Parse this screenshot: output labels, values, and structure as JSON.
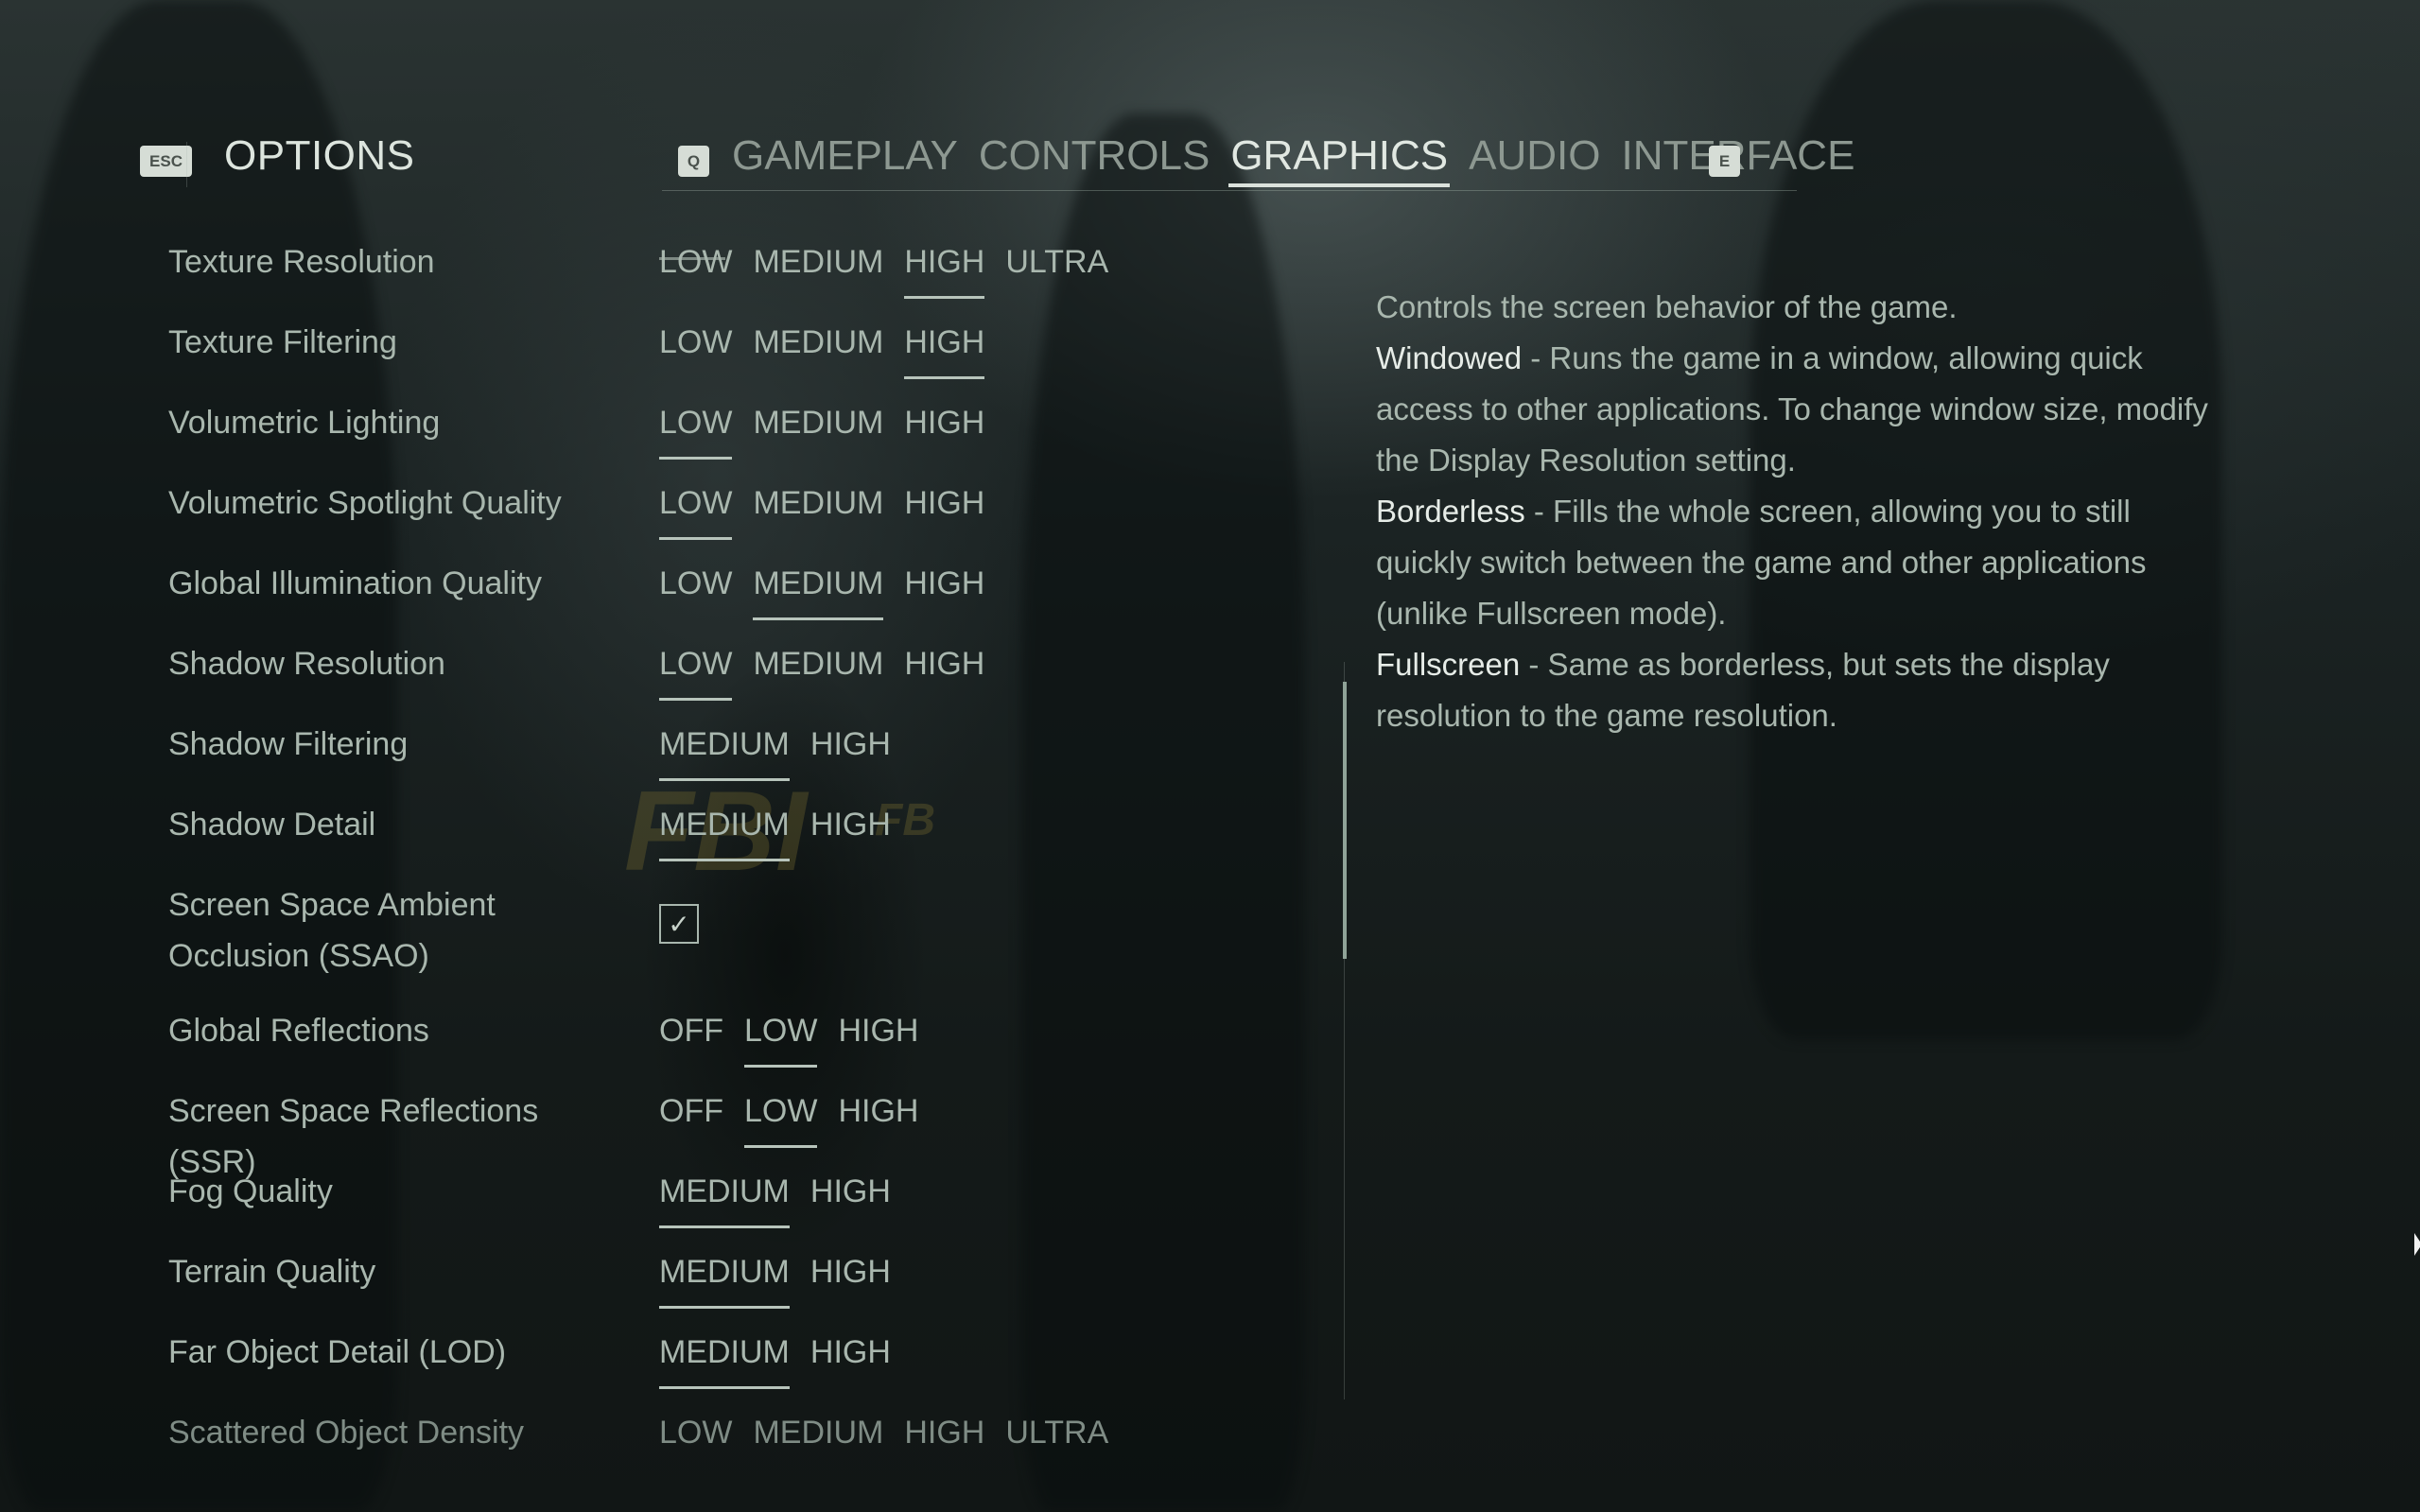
{
  "header": {
    "back_key": "ESC",
    "title": "OPTIONS",
    "prev_tab_key": "Q",
    "next_tab_key": "E",
    "tabs": [
      {
        "label": "GAMEPLAY",
        "active": false
      },
      {
        "label": "CONTROLS",
        "active": false
      },
      {
        "label": "GRAPHICS",
        "active": true
      },
      {
        "label": "AUDIO",
        "active": false
      },
      {
        "label": "INTERFACE",
        "active": false
      }
    ]
  },
  "settings": [
    {
      "label": "Texture Resolution",
      "options": [
        "LOW",
        "MEDIUM",
        "HIGH",
        "ULTRA"
      ],
      "selected": "HIGH"
    },
    {
      "label": "Texture Filtering",
      "options": [
        "LOW",
        "MEDIUM",
        "HIGH"
      ],
      "selected": "HIGH"
    },
    {
      "label": "Volumetric Lighting",
      "options": [
        "LOW",
        "MEDIUM",
        "HIGH"
      ],
      "selected": "LOW"
    },
    {
      "label": "Volumetric Spotlight Quality",
      "options": [
        "LOW",
        "MEDIUM",
        "HIGH"
      ],
      "selected": "LOW"
    },
    {
      "label": "Global Illumination Quality",
      "options": [
        "LOW",
        "MEDIUM",
        "HIGH"
      ],
      "selected": "MEDIUM"
    },
    {
      "label": "Shadow Resolution",
      "options": [
        "LOW",
        "MEDIUM",
        "HIGH"
      ],
      "selected": "LOW"
    },
    {
      "label": "Shadow Filtering",
      "options": [
        "MEDIUM",
        "HIGH"
      ],
      "selected": "MEDIUM"
    },
    {
      "label": "Shadow Detail",
      "options": [
        "MEDIUM",
        "HIGH"
      ],
      "selected": "MEDIUM"
    },
    {
      "label": "Screen Space Ambient Occlusion (SSAO)",
      "type": "checkbox",
      "checked": true
    },
    {
      "label": "Global Reflections",
      "options": [
        "OFF",
        "LOW",
        "HIGH"
      ],
      "selected": "LOW"
    },
    {
      "label": "Screen Space Reflections (SSR)",
      "options": [
        "OFF",
        "LOW",
        "HIGH"
      ],
      "selected": "LOW"
    },
    {
      "label": "Fog Quality",
      "options": [
        "MEDIUM",
        "HIGH"
      ],
      "selected": "MEDIUM"
    },
    {
      "label": "Terrain Quality",
      "options": [
        "MEDIUM",
        "HIGH"
      ],
      "selected": "MEDIUM"
    },
    {
      "label": "Far Object Detail (LOD)",
      "options": [
        "MEDIUM",
        "HIGH"
      ],
      "selected": "MEDIUM"
    },
    {
      "label": "Scattered Object Density",
      "options": [
        "LOW",
        "MEDIUM",
        "HIGH",
        "ULTRA"
      ],
      "selected": null,
      "faded": true
    }
  ],
  "checkbox_glyph": "✓",
  "description": {
    "intro": "Controls the screen behavior of the game.",
    "items": [
      {
        "term": "Windowed",
        "text": " - Runs the game in a window, allowing quick access to other applications. To change window size, modify the Display Resolution setting."
      },
      {
        "term": "Borderless",
        "text": " - Fills the whole screen, allowing you to still quickly switch between the game and other applications (unlike Fullscreen mode)."
      },
      {
        "term": "Fullscreen",
        "text": " - Same as borderless, but sets the display resolution to the game resolution."
      }
    ]
  },
  "scroll": {
    "position_fraction": 0.0,
    "visible_fraction": 0.38
  }
}
